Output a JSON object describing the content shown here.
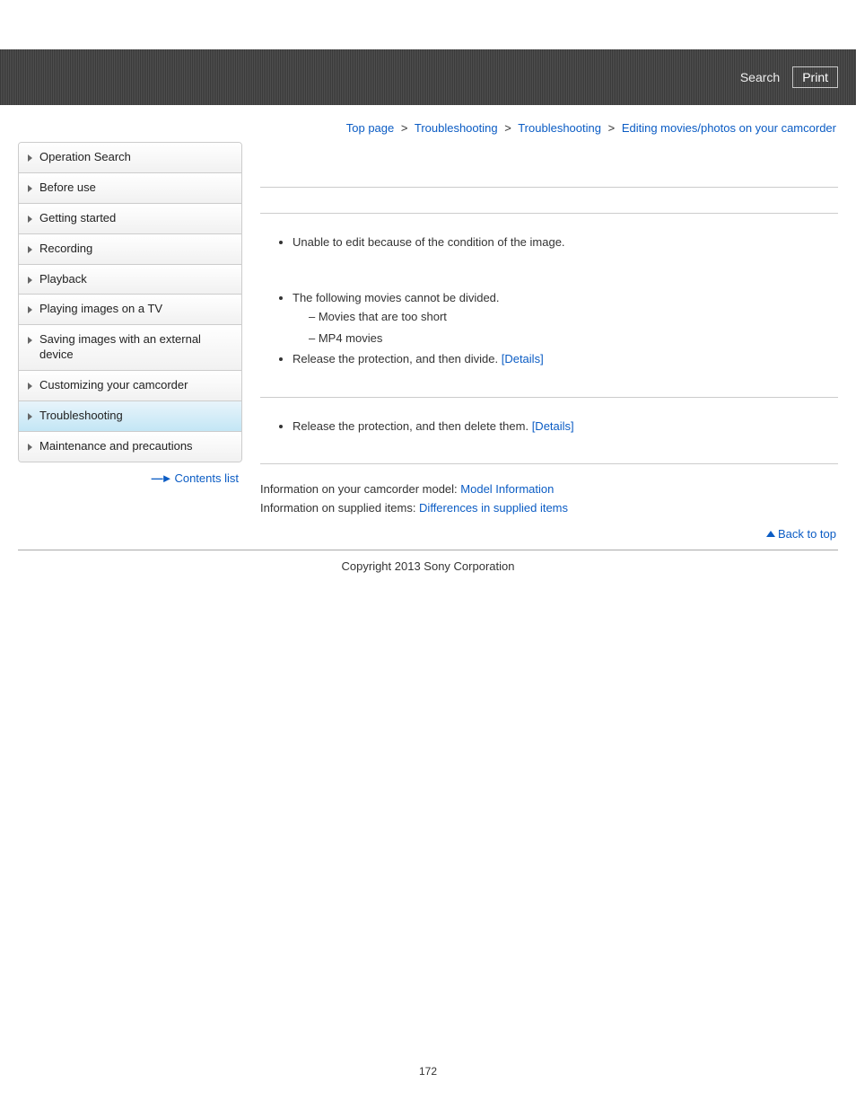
{
  "header": {
    "search": "Search",
    "print": "Print"
  },
  "breadcrumb": {
    "top": "Top page",
    "l1": "Troubleshooting",
    "l2": "Troubleshooting",
    "current": "Editing movies/photos on your camcorder",
    "sep": ">"
  },
  "sidebar": {
    "items": [
      {
        "label": "Operation Search",
        "active": false
      },
      {
        "label": "Before use",
        "active": false
      },
      {
        "label": "Getting started",
        "active": false
      },
      {
        "label": "Recording",
        "active": false
      },
      {
        "label": "Playback",
        "active": false
      },
      {
        "label": "Playing images on a TV",
        "active": false
      },
      {
        "label": "Saving images with an external device",
        "active": false
      },
      {
        "label": "Customizing your camcorder",
        "active": false
      },
      {
        "label": "Troubleshooting",
        "active": true
      },
      {
        "label": "Maintenance and precautions",
        "active": false
      }
    ],
    "contents_list": "Contents list"
  },
  "sections": {
    "s1_item1": "Unable to edit because of the condition of the image.",
    "s2_item1": "The following movies cannot be divided.",
    "s2_sub1": "Movies that are too short",
    "s2_sub2": "MP4 movies",
    "s2_item2_prefix": "Release the protection, and then divide. ",
    "s2_item2_link": "[Details]",
    "s3_item1_prefix": "Release the protection, and then delete them. ",
    "s3_item1_link": "[Details]"
  },
  "info": {
    "model_prefix": "Information on your camcorder model: ",
    "model_link": "Model Information",
    "supplied_prefix": "Information on supplied items: ",
    "supplied_link": "Differences in supplied items"
  },
  "back_to_top": "Back to top",
  "footer": "Copyright 2013 Sony Corporation",
  "page_number": "172"
}
